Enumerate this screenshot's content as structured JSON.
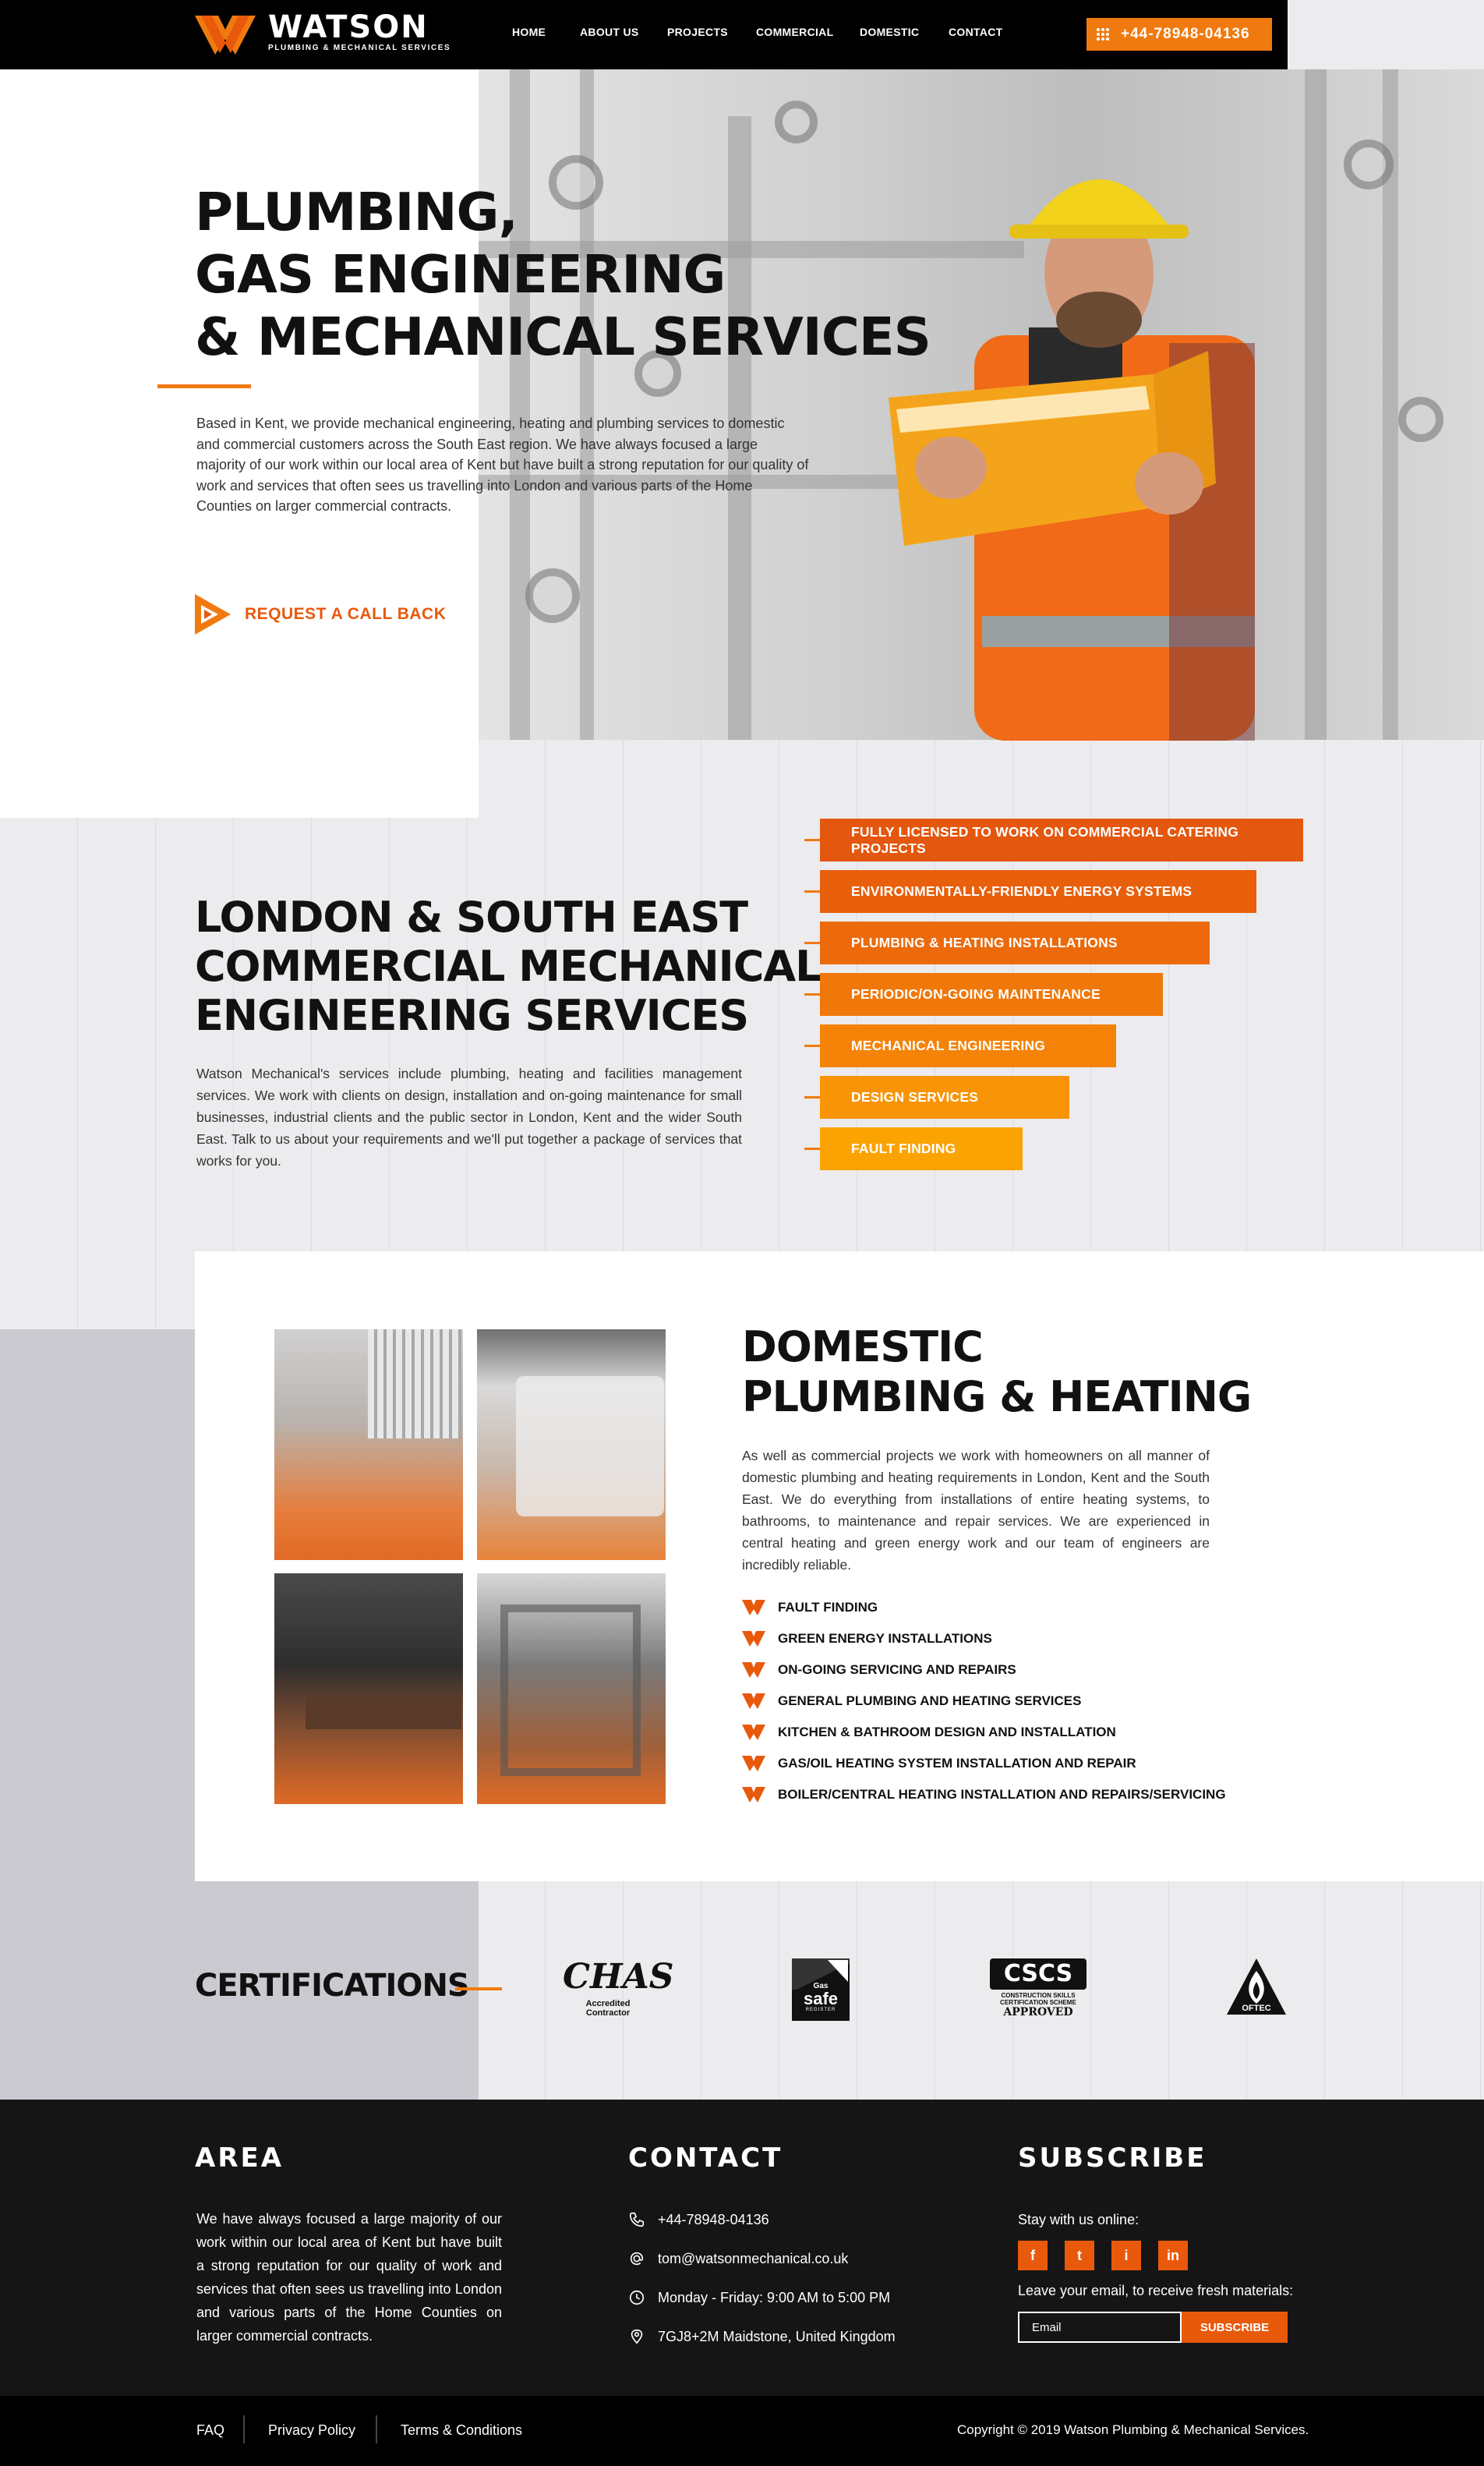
{
  "brand": {
    "name": "WATSON",
    "tagline": "PLUMBING & MECHANICAL SERVICES"
  },
  "nav": {
    "items": [
      "HOME",
      "ABOUT US",
      "PROJECTS",
      "COMMERCIAL",
      "DOMESTIC",
      "CONTACT"
    ]
  },
  "header": {
    "phone": "+44-78948-04136"
  },
  "hero": {
    "title": "PLUMBING,\nGAS ENGINEERING\n& MECHANICAL SERVICES",
    "text": "Based in Kent, we provide mechanical engineering, heating and plumbing services to domestic and commercial customers across the South East region. We have always focused a large majority of our work within our local area of Kent but have built a strong reputation for our quality of work and services that often sees us travelling into London and various parts of the Home Counties on larger commercial contracts.",
    "cta": "REQUEST A CALL BACK"
  },
  "commercial": {
    "title": "LONDON & SOUTH EAST\nCOMMERCIAL MECHANICAL\nENGINEERING SERVICES",
    "text": "Watson Mechanical's services include plumbing, heating and facilities management services. We work with clients on design, installation and on-going maintenance for small businesses, industrial clients and the public sector in London, Kent and the wider South East. Talk to us about your requirements and we'll put together a package of services that works for you.",
    "services": [
      {
        "label": "FULLY LICENSED TO WORK ON COMMERCIAL CATERING PROJECTS",
        "color": "#e4570e"
      },
      {
        "label": "ENVIRONMENTALLY-FRIENDLY ENERGY SYSTEMS",
        "color": "#e85f0c"
      },
      {
        "label": "PLUMBING & HEATING INSTALLATIONS",
        "color": "#ec6a0b"
      },
      {
        "label": "PERIODIC/ON-GOING MAINTENANCE",
        "color": "#f07709"
      },
      {
        "label": "MECHANICAL ENGINEERING",
        "color": "#f48307"
      },
      {
        "label": "DESIGN SERVICES",
        "color": "#f89405"
      },
      {
        "label": "FAULT FINDING",
        "color": "#fba303"
      }
    ]
  },
  "domestic": {
    "title": "DOMESTIC\nPLUMBING & HEATING",
    "text": "As well as commercial projects we work with homeowners on all manner of domestic plumbing and heating requirements in London, Kent and the South East. We do everything from installations of entire heating systems, to bathrooms, to maintenance and repair services. We are experienced in central heating and green energy work and our team of engineers are incredibly reliable.",
    "items": [
      "FAULT FINDING",
      "GREEN ENERGY INSTALLATIONS",
      "ON-GOING SERVICING AND REPAIRS",
      "GENERAL PLUMBING AND HEATING SERVICES",
      "KITCHEN & BATHROOM DESIGN AND INSTALLATION",
      "GAS/OIL HEATING SYSTEM INSTALLATION AND REPAIR",
      "BOILER/CENTRAL HEATING INSTALLATION AND REPAIRS/SERVICING"
    ]
  },
  "certifications": {
    "title": "CERTIFICATIONS",
    "chas": {
      "logo": "CHAS",
      "sub": "Accredited Contractor"
    },
    "gassafe": {
      "small": "Gas",
      "logo": "safe",
      "sub": "REGISTER"
    },
    "cscs": {
      "logo": "CSCS",
      "line1": "CONSTRUCTION SKILLS",
      "line2": "CERTIFICATION SCHEME",
      "line3": "APPROVED"
    },
    "oftec": {
      "logo": "OFTEC"
    }
  },
  "footer": {
    "area": {
      "title": "AREA",
      "text": "We have always focused a large majority of our work within our local area of Kent but have built a strong reputation for our quality of work and services that often sees us travelling into London and various parts of the Home Counties on larger commercial contracts."
    },
    "contact": {
      "title": "CONTACT",
      "phone": "+44-78948-04136",
      "email": "tom@watsonmechanical.co.uk",
      "hours": "Monday - Friday: 9:00 AM to 5:00 PM",
      "address": "7GJ8+2M Maidstone, United Kingdom"
    },
    "subscribe": {
      "title": "SUBSCRIBE",
      "stay": "Stay with us online:",
      "social": [
        "f",
        "t",
        "i",
        "in"
      ],
      "prompt": "Leave your email, to receive fresh materials:",
      "placeholder": "Email",
      "button": "SUBSCRIBE"
    },
    "links": [
      "FAQ",
      "Privacy Policy",
      "Terms & Conditions"
    ],
    "copyright": "Copyright © 2019 Watson Plumbing & Mechanical Services."
  },
  "colors": {
    "accent": "#f07a10",
    "accent_dark": "#e8590c",
    "footer": "#151515"
  }
}
